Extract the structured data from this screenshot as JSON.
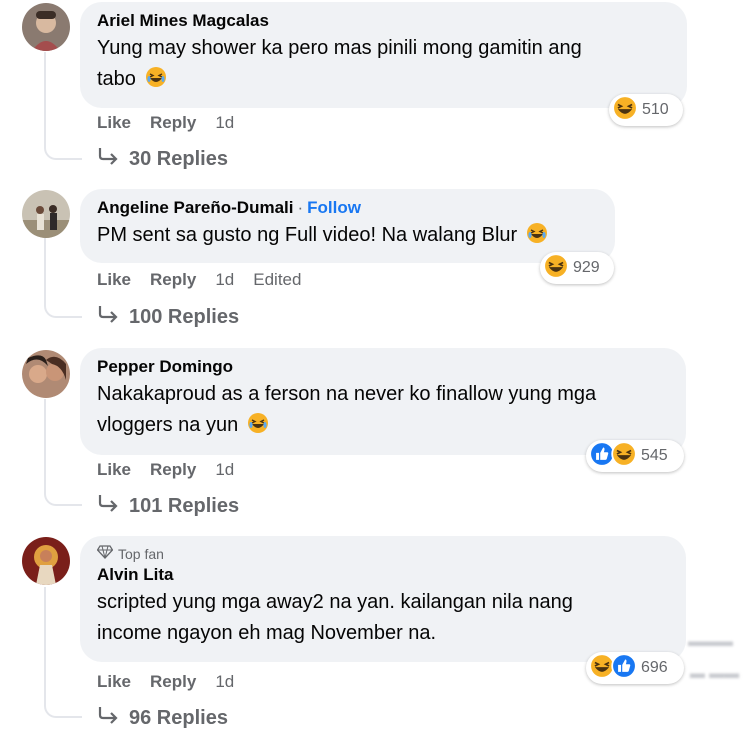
{
  "comments": [
    {
      "author": "Ariel Mines Magcalas",
      "text": "Yung may shower ka pero mas pinili mong gamitin ang tabo",
      "text_line1": "Yung may shower ka pero mas pinili mong gamitin ang",
      "text_line2": "tabo",
      "reactions": [
        "haha"
      ],
      "reaction_count": "510",
      "like": "Like",
      "reply": "Reply",
      "time": "1d",
      "replies": "30 Replies"
    },
    {
      "author": "Angeline Pareño-Dumali",
      "follow": "Follow",
      "text": "PM sent sa gusto ng Full video! Na walang Blur",
      "reactions": [
        "haha"
      ],
      "reaction_count": "929",
      "like": "Like",
      "reply": "Reply",
      "time": "1d",
      "edited": "Edited",
      "replies": "100 Replies"
    },
    {
      "author": "Pepper Domingo",
      "text_line1": "Nakakaproud as a ferson na never ko finallow yung mga",
      "text_line2": "vloggers na yun",
      "reactions": [
        "like",
        "haha"
      ],
      "reaction_count": "545",
      "like": "Like",
      "reply": "Reply",
      "time": "1d",
      "replies": "101 Replies"
    },
    {
      "badge": "Top fan",
      "author": "Alvin Lita",
      "text_line1": "scripted yung mga away2 na yan. kailangan nila nang",
      "text_line2": "income ngayon eh mag November na.",
      "reactions": [
        "haha",
        "like"
      ],
      "reaction_count": "696",
      "like": "Like",
      "reply": "Reply",
      "time": "1d",
      "replies": "96 Replies"
    }
  ],
  "colors": {
    "bubble": "#f0f2f5",
    "secondary_text": "#65676b",
    "link": "#1877f2",
    "haha": "#f7b125",
    "like": "#1877f2"
  },
  "icons": [
    "haha-emoji-icon",
    "like-reaction-icon",
    "haha-reaction-icon",
    "reply-arrow-icon",
    "diamond-icon"
  ]
}
